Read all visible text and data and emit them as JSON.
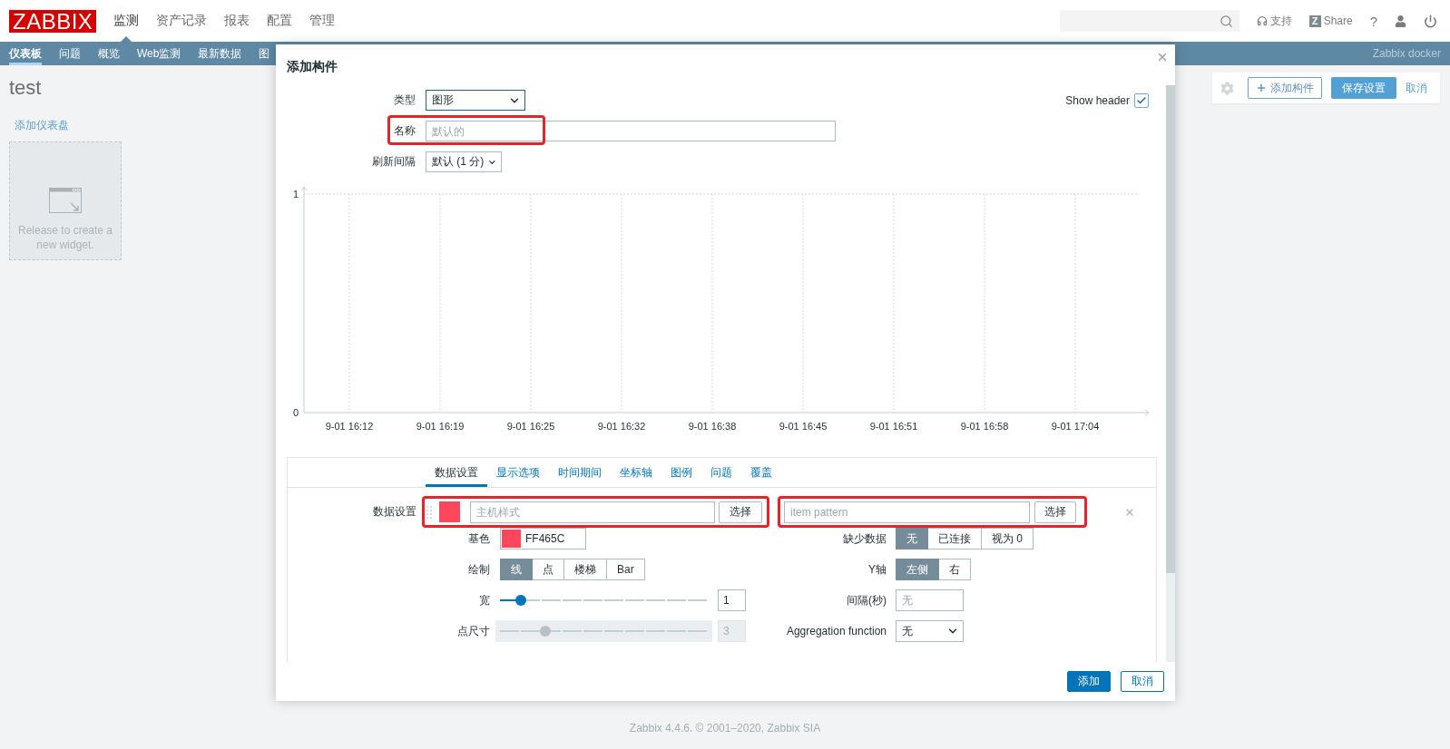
{
  "header": {
    "logo": "ZABBIX",
    "menu": [
      {
        "label": "监测",
        "selected": true
      },
      {
        "label": "资产记录",
        "selected": false
      },
      {
        "label": "报表",
        "selected": false
      },
      {
        "label": "配置",
        "selected": false
      },
      {
        "label": "管理",
        "selected": false
      }
    ],
    "support": "支持",
    "share": {
      "logo": "Z",
      "label": "Share"
    },
    "help": "?"
  },
  "subnav": {
    "items": [
      {
        "label": "仪表板",
        "selected": true
      },
      {
        "label": "问题",
        "selected": false
      },
      {
        "label": "概览",
        "selected": false
      },
      {
        "label": "Web监测",
        "selected": false
      },
      {
        "label": "最新数据",
        "selected": false
      },
      {
        "label": "图",
        "selected": false
      }
    ],
    "server_name": "Zabbix docker"
  },
  "dashboard": {
    "title": "test",
    "add_dashboard": "添加仪表盘",
    "drop_zone": "Release to create a new widget.",
    "toolbar": {
      "add_widget": "添加构件",
      "save": "保存设置",
      "cancel": "取消"
    }
  },
  "dialog": {
    "title": "添加构件",
    "form": {
      "type": {
        "label": "类型",
        "value": "图形",
        "focused": true
      },
      "show_header": {
        "label": "Show header",
        "checked": true
      },
      "name": {
        "label": "名称",
        "placeholder": "默认的",
        "highlighted": true
      },
      "refresh": {
        "label": "刷新间隔",
        "value": "默认 (1 分)"
      }
    },
    "chart_data": {
      "type": "line",
      "categories": [
        "9-01 16:12",
        "9-01 16:19",
        "9-01 16:25",
        "9-01 16:32",
        "9-01 16:38",
        "9-01 16:45",
        "9-01 16:51",
        "9-01 16:58",
        "9-01 17:04"
      ],
      "ylim": [
        0,
        1
      ],
      "yticks": [
        0,
        1
      ],
      "grid": true
    },
    "tabs": [
      {
        "label": "数据设置",
        "selected": true
      },
      {
        "label": "显示选项",
        "selected": false
      },
      {
        "label": "时间期间",
        "selected": false
      },
      {
        "label": "坐标轴",
        "selected": false
      },
      {
        "label": "图例",
        "selected": false
      },
      {
        "label": "问题",
        "selected": false
      },
      {
        "label": "覆盖",
        "selected": false
      }
    ],
    "data_set": {
      "label": "数据设置",
      "color": "#ff465c",
      "host": {
        "placeholder": "主机样式",
        "button": "选择",
        "highlighted": true
      },
      "item": {
        "placeholder": "item pattern",
        "button": "选择",
        "highlighted": true
      },
      "settings": [
        {
          "kind": "color",
          "label": "基色",
          "color": "#ff465c",
          "value": "FF465C"
        },
        {
          "kind": "segmented",
          "label": "缺少数据",
          "options": [
            {
              "label": "无",
              "selected": true
            },
            {
              "label": "已连接",
              "selected": false
            },
            {
              "label": "视为 0",
              "selected": false
            }
          ]
        },
        {
          "kind": "segmented",
          "label": "绘制",
          "options": [
            {
              "label": "线",
              "selected": true
            },
            {
              "label": "点",
              "selected": false
            },
            {
              "label": "楼梯",
              "selected": false
            },
            {
              "label": "Bar",
              "selected": false
            }
          ]
        },
        {
          "kind": "segmented",
          "label": "Y轴",
          "options": [
            {
              "label": "左侧",
              "selected": true
            },
            {
              "label": "右",
              "selected": false
            }
          ]
        },
        {
          "kind": "slider",
          "label": "宽",
          "level": 0.1,
          "value": "1",
          "disabled": false
        },
        {
          "kind": "input",
          "label": "间隔(秒)",
          "placeholder": "无"
        },
        {
          "kind": "slider",
          "label": "点尺寸",
          "level": 0.22,
          "value": "3",
          "disabled": true
        },
        {
          "kind": "select",
          "label": "Aggregation function",
          "value": "无"
        }
      ]
    },
    "buttons": [
      {
        "kind": "primary",
        "label": "添加"
      },
      {
        "kind": "secondary",
        "label": "取消"
      }
    ]
  },
  "footer": "Zabbix 4.4.6. © 2001–2020, Zabbix SIA"
}
